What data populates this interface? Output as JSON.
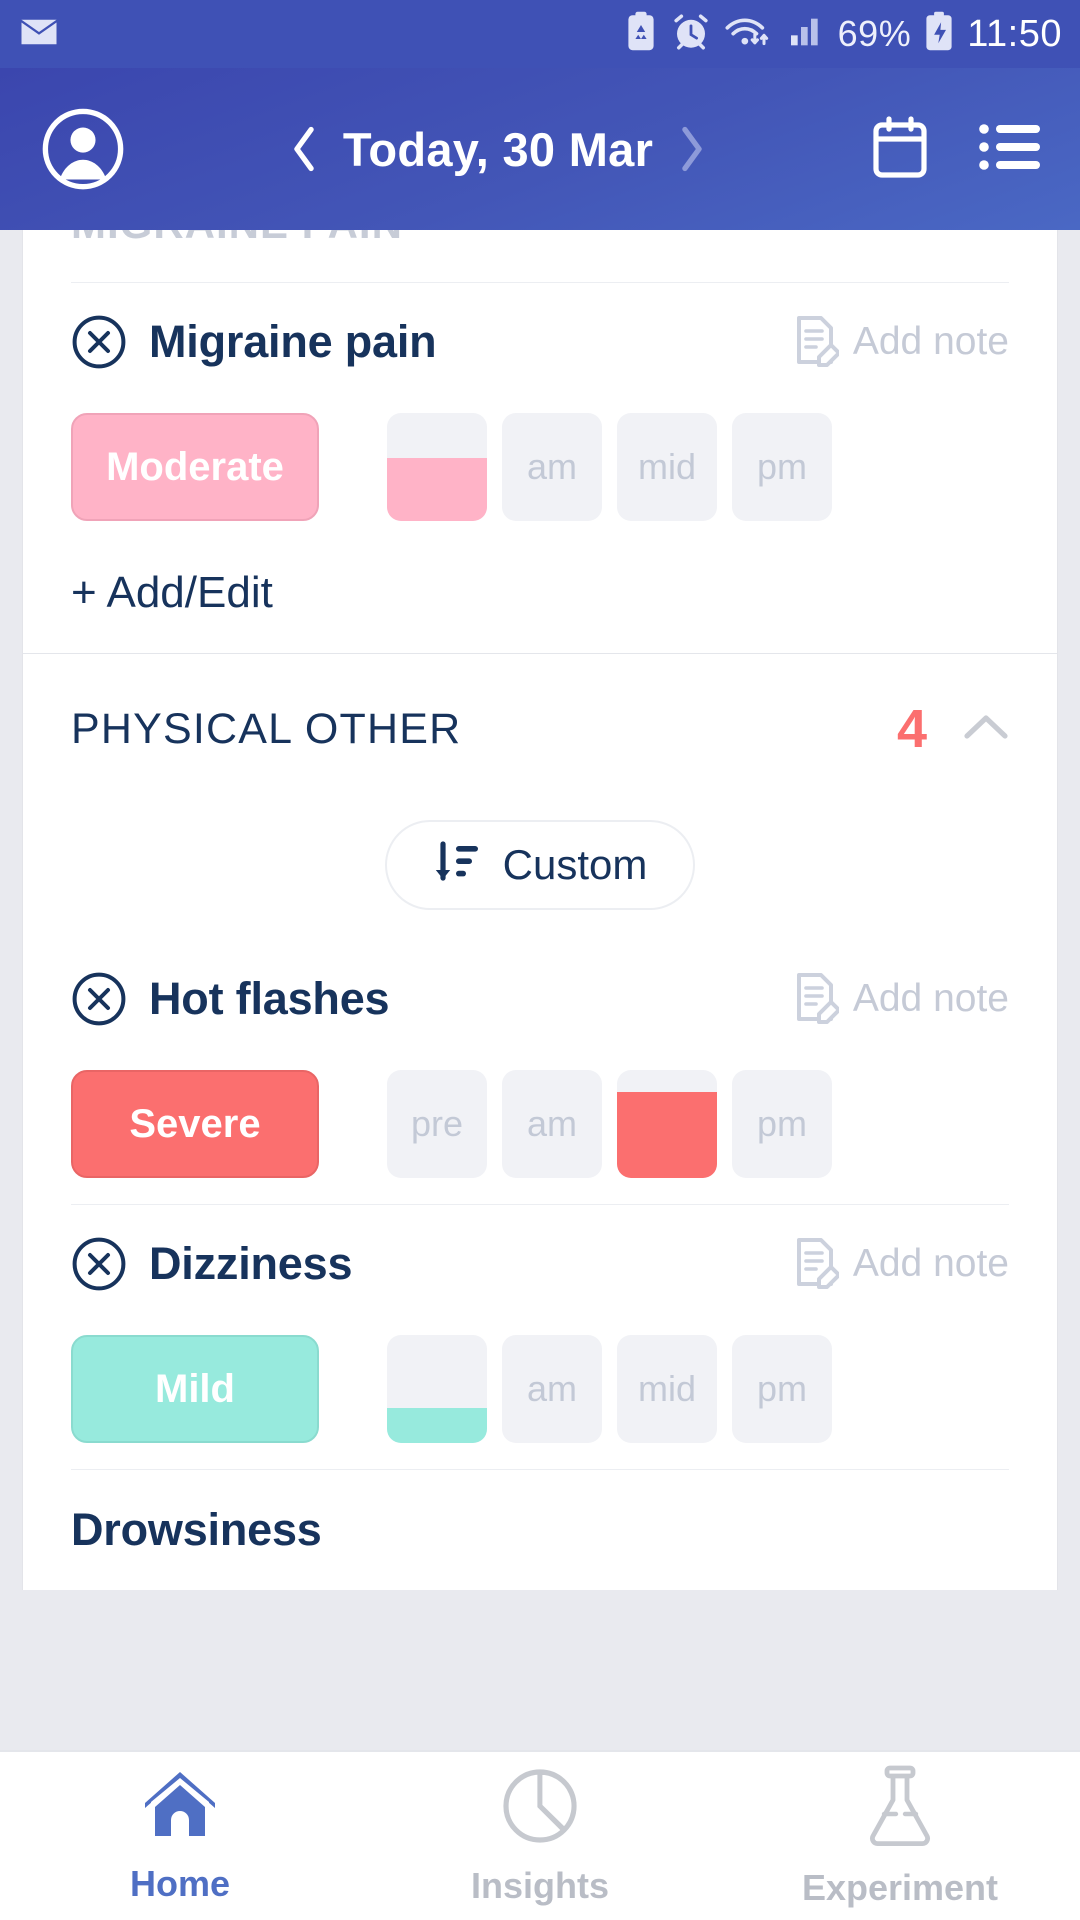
{
  "status_bar": {
    "mail_icon": "mail-icon",
    "clipboard_icon": "clipboard-recycle-icon",
    "alarm_icon": "alarm-icon",
    "wifi_icon": "wifi-data-icon",
    "signal_icon": "cell-signal-icon",
    "battery_percent": "69%",
    "battery_icon": "battery-charging-icon",
    "time": "11:50"
  },
  "header": {
    "avatar_icon": "profile-avatar-icon",
    "prev_icon": "chevron-left-icon",
    "date_title": "Today, 30 Mar",
    "next_icon": "chevron-right-icon",
    "calendar_icon": "calendar-icon",
    "menu_icon": "list-menu-icon"
  },
  "content": {
    "clipped_section_title": "MIGRAINE PAIN",
    "add_note_label": "Add note",
    "add_edit_label": "+ Add/Edit",
    "sort": {
      "icon": "sort-descending-icon",
      "label": "Custom"
    },
    "section": {
      "title": "PHYSICAL OTHER",
      "count": "4",
      "collapse_icon": "chevron-up-icon"
    },
    "symptoms": [
      {
        "name": "Migraine pain",
        "remove_icon": "close-circle-icon",
        "severity": "Moderate",
        "severity_class": "sev-moderate",
        "fill_class": "fill-moderate",
        "times": [
          {
            "label": "",
            "fill_percent": 58
          },
          {
            "label": "am",
            "fill_percent": 0
          },
          {
            "label": "mid",
            "fill_percent": 0
          },
          {
            "label": "pm",
            "fill_percent": 0
          }
        ]
      },
      {
        "name": "Hot flashes",
        "remove_icon": "close-circle-icon",
        "severity": "Severe",
        "severity_class": "sev-severe",
        "fill_class": "fill-severe",
        "times": [
          {
            "label": "pre",
            "fill_percent": 0
          },
          {
            "label": "am",
            "fill_percent": 0
          },
          {
            "label": "",
            "fill_percent": 80
          },
          {
            "label": "pm",
            "fill_percent": 0
          }
        ]
      },
      {
        "name": "Dizziness",
        "remove_icon": "close-circle-icon",
        "severity": "Mild",
        "severity_class": "sev-mild",
        "fill_class": "fill-mild",
        "times": [
          {
            "label": "",
            "fill_percent": 32
          },
          {
            "label": "am",
            "fill_percent": 0
          },
          {
            "label": "mid",
            "fill_percent": 0
          },
          {
            "label": "pm",
            "fill_percent": 0
          }
        ]
      },
      {
        "name": "Drowsiness",
        "remove_icon": "",
        "severity": "",
        "severity_class": "",
        "fill_class": "",
        "times": []
      }
    ]
  },
  "bottom_nav": {
    "items": [
      {
        "label": "Home",
        "icon": "home-icon",
        "active": true
      },
      {
        "label": "Insights",
        "icon": "pie-chart-icon",
        "active": false
      },
      {
        "label": "Experiment",
        "icon": "flask-icon",
        "active": false
      }
    ]
  },
  "colors": {
    "header_blue": "#3f51b5",
    "accent_navy": "#17335c",
    "severe_red": "#fb6f6f",
    "moderate_pink": "#ffb3c7",
    "mild_teal": "#97eadd",
    "chip_gray": "#f1f2f6",
    "nav_active": "#4f6fc4"
  }
}
